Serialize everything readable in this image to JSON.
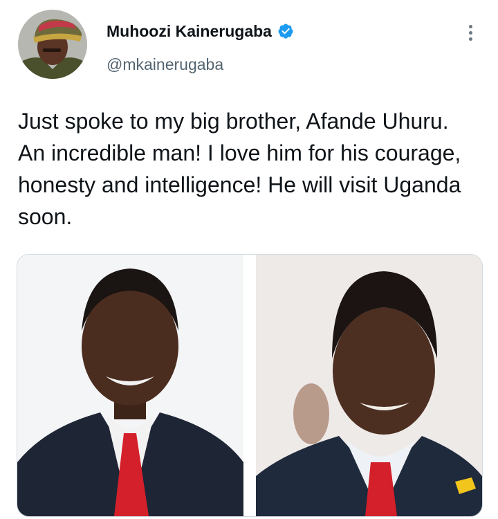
{
  "tweet": {
    "author": {
      "display_name": "Muhoozi Kainerugaba",
      "handle": "@mkainerugaba",
      "verified": true,
      "avatar_icon": "profile-photo"
    },
    "more_icon": "vertical-ellipsis-icon",
    "text": "Just spoke to my big brother, Afande Uhuru. An incredible man! I love him for his courage, honesty and intelligence! He will visit Uganda soon.",
    "media": {
      "count": 2,
      "photos": [
        {
          "description": "portrait photo"
        },
        {
          "description": "portrait photo"
        }
      ]
    }
  },
  "colors": {
    "text_primary": "#0f1419",
    "text_secondary": "#536471",
    "verified_badge": "#1d9bf0",
    "border": "#cfd9de"
  }
}
